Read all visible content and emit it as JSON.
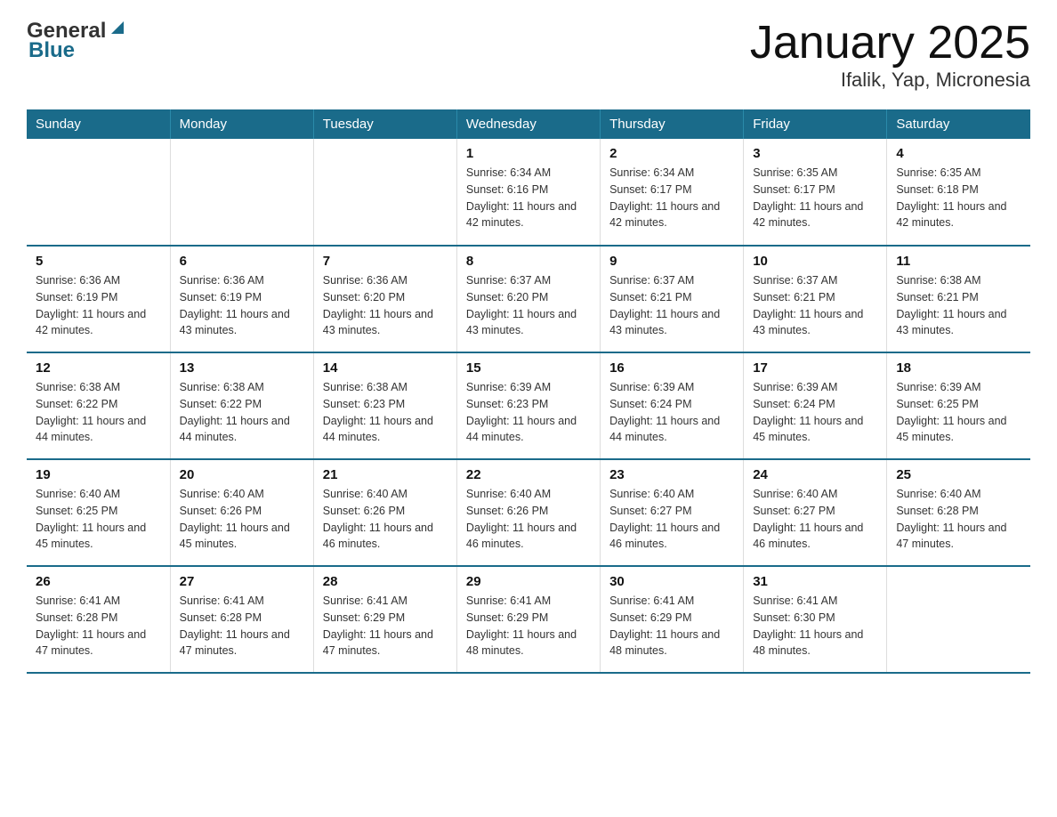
{
  "header": {
    "logo_general": "General",
    "logo_blue": "Blue",
    "title": "January 2025",
    "subtitle": "Ifalik, Yap, Micronesia"
  },
  "days_of_week": [
    "Sunday",
    "Monday",
    "Tuesday",
    "Wednesday",
    "Thursday",
    "Friday",
    "Saturday"
  ],
  "weeks": [
    [
      {
        "day": "",
        "sunrise": "",
        "sunset": "",
        "daylight": ""
      },
      {
        "day": "",
        "sunrise": "",
        "sunset": "",
        "daylight": ""
      },
      {
        "day": "",
        "sunrise": "",
        "sunset": "",
        "daylight": ""
      },
      {
        "day": "1",
        "sunrise": "Sunrise: 6:34 AM",
        "sunset": "Sunset: 6:16 PM",
        "daylight": "Daylight: 11 hours and 42 minutes."
      },
      {
        "day": "2",
        "sunrise": "Sunrise: 6:34 AM",
        "sunset": "Sunset: 6:17 PM",
        "daylight": "Daylight: 11 hours and 42 minutes."
      },
      {
        "day": "3",
        "sunrise": "Sunrise: 6:35 AM",
        "sunset": "Sunset: 6:17 PM",
        "daylight": "Daylight: 11 hours and 42 minutes."
      },
      {
        "day": "4",
        "sunrise": "Sunrise: 6:35 AM",
        "sunset": "Sunset: 6:18 PM",
        "daylight": "Daylight: 11 hours and 42 minutes."
      }
    ],
    [
      {
        "day": "5",
        "sunrise": "Sunrise: 6:36 AM",
        "sunset": "Sunset: 6:19 PM",
        "daylight": "Daylight: 11 hours and 42 minutes."
      },
      {
        "day": "6",
        "sunrise": "Sunrise: 6:36 AM",
        "sunset": "Sunset: 6:19 PM",
        "daylight": "Daylight: 11 hours and 43 minutes."
      },
      {
        "day": "7",
        "sunrise": "Sunrise: 6:36 AM",
        "sunset": "Sunset: 6:20 PM",
        "daylight": "Daylight: 11 hours and 43 minutes."
      },
      {
        "day": "8",
        "sunrise": "Sunrise: 6:37 AM",
        "sunset": "Sunset: 6:20 PM",
        "daylight": "Daylight: 11 hours and 43 minutes."
      },
      {
        "day": "9",
        "sunrise": "Sunrise: 6:37 AM",
        "sunset": "Sunset: 6:21 PM",
        "daylight": "Daylight: 11 hours and 43 minutes."
      },
      {
        "day": "10",
        "sunrise": "Sunrise: 6:37 AM",
        "sunset": "Sunset: 6:21 PM",
        "daylight": "Daylight: 11 hours and 43 minutes."
      },
      {
        "day": "11",
        "sunrise": "Sunrise: 6:38 AM",
        "sunset": "Sunset: 6:21 PM",
        "daylight": "Daylight: 11 hours and 43 minutes."
      }
    ],
    [
      {
        "day": "12",
        "sunrise": "Sunrise: 6:38 AM",
        "sunset": "Sunset: 6:22 PM",
        "daylight": "Daylight: 11 hours and 44 minutes."
      },
      {
        "day": "13",
        "sunrise": "Sunrise: 6:38 AM",
        "sunset": "Sunset: 6:22 PM",
        "daylight": "Daylight: 11 hours and 44 minutes."
      },
      {
        "day": "14",
        "sunrise": "Sunrise: 6:38 AM",
        "sunset": "Sunset: 6:23 PM",
        "daylight": "Daylight: 11 hours and 44 minutes."
      },
      {
        "day": "15",
        "sunrise": "Sunrise: 6:39 AM",
        "sunset": "Sunset: 6:23 PM",
        "daylight": "Daylight: 11 hours and 44 minutes."
      },
      {
        "day": "16",
        "sunrise": "Sunrise: 6:39 AM",
        "sunset": "Sunset: 6:24 PM",
        "daylight": "Daylight: 11 hours and 44 minutes."
      },
      {
        "day": "17",
        "sunrise": "Sunrise: 6:39 AM",
        "sunset": "Sunset: 6:24 PM",
        "daylight": "Daylight: 11 hours and 45 minutes."
      },
      {
        "day": "18",
        "sunrise": "Sunrise: 6:39 AM",
        "sunset": "Sunset: 6:25 PM",
        "daylight": "Daylight: 11 hours and 45 minutes."
      }
    ],
    [
      {
        "day": "19",
        "sunrise": "Sunrise: 6:40 AM",
        "sunset": "Sunset: 6:25 PM",
        "daylight": "Daylight: 11 hours and 45 minutes."
      },
      {
        "day": "20",
        "sunrise": "Sunrise: 6:40 AM",
        "sunset": "Sunset: 6:26 PM",
        "daylight": "Daylight: 11 hours and 45 minutes."
      },
      {
        "day": "21",
        "sunrise": "Sunrise: 6:40 AM",
        "sunset": "Sunset: 6:26 PM",
        "daylight": "Daylight: 11 hours and 46 minutes."
      },
      {
        "day": "22",
        "sunrise": "Sunrise: 6:40 AM",
        "sunset": "Sunset: 6:26 PM",
        "daylight": "Daylight: 11 hours and 46 minutes."
      },
      {
        "day": "23",
        "sunrise": "Sunrise: 6:40 AM",
        "sunset": "Sunset: 6:27 PM",
        "daylight": "Daylight: 11 hours and 46 minutes."
      },
      {
        "day": "24",
        "sunrise": "Sunrise: 6:40 AM",
        "sunset": "Sunset: 6:27 PM",
        "daylight": "Daylight: 11 hours and 46 minutes."
      },
      {
        "day": "25",
        "sunrise": "Sunrise: 6:40 AM",
        "sunset": "Sunset: 6:28 PM",
        "daylight": "Daylight: 11 hours and 47 minutes."
      }
    ],
    [
      {
        "day": "26",
        "sunrise": "Sunrise: 6:41 AM",
        "sunset": "Sunset: 6:28 PM",
        "daylight": "Daylight: 11 hours and 47 minutes."
      },
      {
        "day": "27",
        "sunrise": "Sunrise: 6:41 AM",
        "sunset": "Sunset: 6:28 PM",
        "daylight": "Daylight: 11 hours and 47 minutes."
      },
      {
        "day": "28",
        "sunrise": "Sunrise: 6:41 AM",
        "sunset": "Sunset: 6:29 PM",
        "daylight": "Daylight: 11 hours and 47 minutes."
      },
      {
        "day": "29",
        "sunrise": "Sunrise: 6:41 AM",
        "sunset": "Sunset: 6:29 PM",
        "daylight": "Daylight: 11 hours and 48 minutes."
      },
      {
        "day": "30",
        "sunrise": "Sunrise: 6:41 AM",
        "sunset": "Sunset: 6:29 PM",
        "daylight": "Daylight: 11 hours and 48 minutes."
      },
      {
        "day": "31",
        "sunrise": "Sunrise: 6:41 AM",
        "sunset": "Sunset: 6:30 PM",
        "daylight": "Daylight: 11 hours and 48 minutes."
      },
      {
        "day": "",
        "sunrise": "",
        "sunset": "",
        "daylight": ""
      }
    ]
  ]
}
